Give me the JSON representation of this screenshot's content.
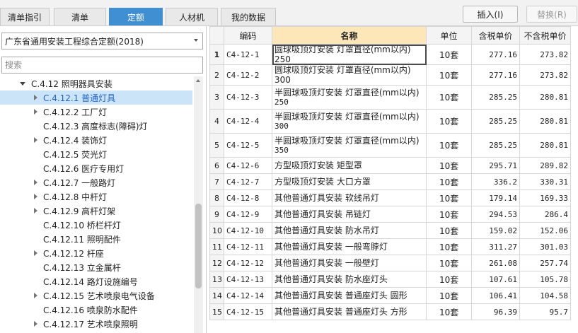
{
  "tabs": [
    {
      "label": "清单指引",
      "active": false
    },
    {
      "label": "清单",
      "active": false
    },
    {
      "label": "定额",
      "active": true
    },
    {
      "label": "人材机",
      "active": false
    },
    {
      "label": "我的数据",
      "active": false
    }
  ],
  "toolbar": {
    "insert_label": "插入(I)",
    "replace_label": "替换(R)"
  },
  "left": {
    "library_select": "广东省通用安装工程综合定额(2018)",
    "search_placeholder": "搜索"
  },
  "tree": [
    {
      "label": "C.4.12 照明器具安装",
      "level": 0,
      "expanded": true,
      "has_children": true,
      "selected": false
    },
    {
      "label": "C.4.12.1 普通灯具",
      "level": 1,
      "has_children": true,
      "selected": true
    },
    {
      "label": "C.4.12.2 工厂灯",
      "level": 1,
      "has_children": true,
      "selected": false
    },
    {
      "label": "C.4.12.3 高度标志(障碍)灯",
      "level": 1,
      "has_children": false,
      "selected": false
    },
    {
      "label": "C.4.12.4 装饰灯",
      "level": 1,
      "has_children": true,
      "selected": false
    },
    {
      "label": "C.4.12.5 荧光灯",
      "level": 1,
      "has_children": false,
      "selected": false
    },
    {
      "label": "C.4.12.6 医疗专用灯",
      "level": 1,
      "has_children": false,
      "selected": false
    },
    {
      "label": "C.4.12.7 一般路灯",
      "level": 1,
      "has_children": true,
      "selected": false
    },
    {
      "label": "C.4.12.8 中杆灯",
      "level": 1,
      "has_children": true,
      "selected": false
    },
    {
      "label": "C.4.12.9 高杆灯架",
      "level": 1,
      "has_children": true,
      "selected": false
    },
    {
      "label": "C.4.12.10 桥栏杆灯",
      "level": 1,
      "has_children": false,
      "selected": false
    },
    {
      "label": "C.4.12.11 照明配件",
      "level": 1,
      "has_children": false,
      "selected": false
    },
    {
      "label": "C.4.12.12 杆座",
      "level": 1,
      "has_children": true,
      "selected": false
    },
    {
      "label": "C.4.12.13 立金属杆",
      "level": 1,
      "has_children": false,
      "selected": false
    },
    {
      "label": "C.4.12.14 路灯设施编号",
      "level": 1,
      "has_children": false,
      "selected": false
    },
    {
      "label": "C.4.12.15 艺术喷泉电气设备",
      "level": 1,
      "has_children": true,
      "selected": false
    },
    {
      "label": "C.4.12.16 喷泉防水配件",
      "level": 1,
      "has_children": false,
      "selected": false
    },
    {
      "label": "C.4.12.17 艺术喷泉照明",
      "level": 1,
      "has_children": true,
      "selected": false
    }
  ],
  "table": {
    "headers": [
      "",
      "编码",
      "名称",
      "单位",
      "含税单价",
      "不含税单价"
    ],
    "rows": [
      {
        "idx": "1",
        "code": "C4-12-1",
        "name": "圆球吸顶灯安装 灯罩直径(mm以内) 250",
        "name_sub": "",
        "unit": "10套",
        "price_tax": "277.16",
        "price_notax": "273.82"
      },
      {
        "idx": "2",
        "code": "C4-12-2",
        "name": "圆球吸顶灯安装 灯罩直径(mm以内) 300",
        "name_sub": "",
        "unit": "10套",
        "price_tax": "277.16",
        "price_notax": "273.82"
      },
      {
        "idx": "3",
        "code": "C4-12-3",
        "name": "半圆球吸顶灯安装 灯罩直径(mm以内)",
        "name_sub": "250",
        "unit": "10套",
        "price_tax": "285.25",
        "price_notax": "280.81"
      },
      {
        "idx": "4",
        "code": "C4-12-4",
        "name": "半圆球吸顶灯安装 灯罩直径(mm以内)",
        "name_sub": "300",
        "unit": "10套",
        "price_tax": "285.25",
        "price_notax": "280.81"
      },
      {
        "idx": "5",
        "code": "C4-12-5",
        "name": "半圆球吸顶灯安装 灯罩直径(mm以内)",
        "name_sub": "350",
        "unit": "10套",
        "price_tax": "285.25",
        "price_notax": "280.81"
      },
      {
        "idx": "6",
        "code": "C4-12-6",
        "name": "方型吸顶灯安装 矩型罩",
        "name_sub": "",
        "unit": "10套",
        "price_tax": "295.71",
        "price_notax": "289.82"
      },
      {
        "idx": "7",
        "code": "C4-12-7",
        "name": "方型吸顶灯安装 大口方罩",
        "name_sub": "",
        "unit": "10套",
        "price_tax": "336.2",
        "price_notax": "330.31"
      },
      {
        "idx": "8",
        "code": "C4-12-8",
        "name": "其他普通灯具安装 软线吊灯",
        "name_sub": "",
        "unit": "10套",
        "price_tax": "179.14",
        "price_notax": "169.33"
      },
      {
        "idx": "9",
        "code": "C4-12-9",
        "name": "其他普通灯具安装 吊链灯",
        "name_sub": "",
        "unit": "10套",
        "price_tax": "294.53",
        "price_notax": "286.4"
      },
      {
        "idx": "10",
        "code": "C4-12-10",
        "name": "其他普通灯具安装 防水吊灯",
        "name_sub": "",
        "unit": "10套",
        "price_tax": "159.02",
        "price_notax": "152.06"
      },
      {
        "idx": "11",
        "code": "C4-12-11",
        "name": "其他普通灯具安装 一般弯脖灯",
        "name_sub": "",
        "unit": "10套",
        "price_tax": "311.27",
        "price_notax": "301.03"
      },
      {
        "idx": "12",
        "code": "C4-12-12",
        "name": "其他普通灯具安装 一般壁灯",
        "name_sub": "",
        "unit": "10套",
        "price_tax": "261.08",
        "price_notax": "257.74"
      },
      {
        "idx": "13",
        "code": "C4-12-13",
        "name": "其他普通灯具安装 防水座灯头",
        "name_sub": "",
        "unit": "10套",
        "price_tax": "107.61",
        "price_notax": "105.78"
      },
      {
        "idx": "14",
        "code": "C4-12-14",
        "name": "其他普通灯具安装 普通座灯头 圆形",
        "name_sub": "",
        "unit": "10套",
        "price_tax": "106.41",
        "price_notax": "104.58"
      },
      {
        "idx": "15",
        "code": "C4-12-15",
        "name": "其他普通灯具安装 普通座灯头 方形",
        "name_sub": "",
        "unit": "10套",
        "price_tax": "96.39",
        "price_notax": "95.7"
      }
    ]
  }
}
